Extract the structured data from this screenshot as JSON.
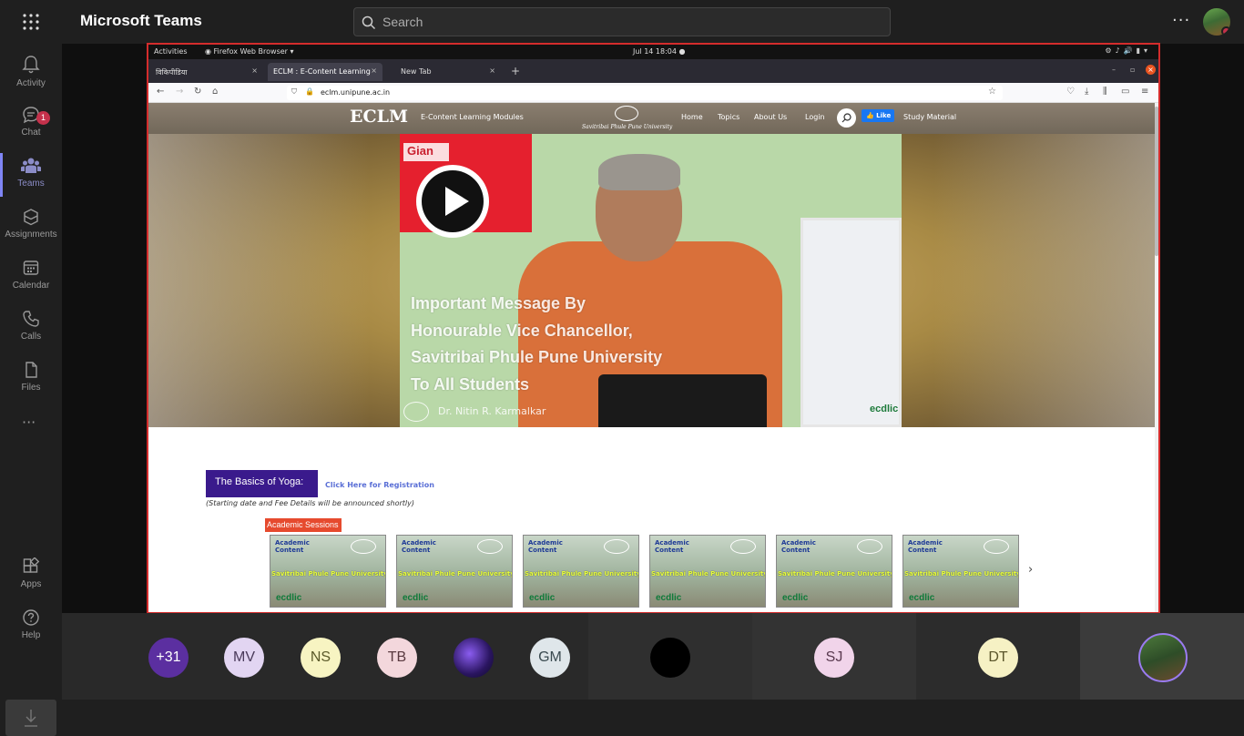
{
  "teams": {
    "title": "Microsoft Teams",
    "search_placeholder": "Search",
    "more_label": "···"
  },
  "rail": {
    "items": [
      {
        "label": "Activity",
        "icon": "bell-icon"
      },
      {
        "label": "Chat",
        "icon": "chat-icon",
        "badge": "1"
      },
      {
        "label": "Teams",
        "icon": "teams-icon"
      },
      {
        "label": "Assignments",
        "icon": "assignments-icon"
      },
      {
        "label": "Calendar",
        "icon": "calendar-icon"
      },
      {
        "label": "Calls",
        "icon": "phone-icon"
      },
      {
        "label": "Files",
        "icon": "file-icon"
      }
    ],
    "more": "···",
    "apps": "Apps",
    "help": "Help"
  },
  "ubuntu": {
    "activities": "Activities",
    "app_menu": "Firefox Web Browser ▾",
    "clock": "Jul 14  18:04  ●"
  },
  "browser": {
    "tabs": [
      {
        "label": "विकिपीडिया",
        "close": "×"
      },
      {
        "label": "ECLM : E-Content Learning",
        "close": "×"
      },
      {
        "label": "New Tab",
        "close": "×"
      }
    ],
    "new_tab": "+",
    "url": "eclm.unipune.ac.in"
  },
  "site": {
    "logo": "ECLM",
    "subtitle": "E-Content Learning Modules",
    "university": "Savitribai Phule Pune University",
    "nav": [
      "Home",
      "Topics",
      "About Us",
      "Login"
    ],
    "like": "Like",
    "study": "Study Material",
    "hero": {
      "brand": "Gian",
      "message_lines": [
        "Important Message By",
        "Honourable Vice Chancellor,",
        "Savitribai Phule Pune University",
        "To All Students"
      ],
      "presenter": "Dr. Nitin R. Karmalkar",
      "watermark": "ecdlic"
    },
    "yoga": {
      "title": "The Basics of Yoga:",
      "link": "Click Here for Registration",
      "note": "(Starting date and Fee Details will be announced shortly)"
    },
    "academic_label": "Academic Sessions",
    "card": {
      "top_line1": "Academic",
      "top_line2": "Content",
      "univ": "Savitribai Phule Pune University",
      "brand": "ecdlic"
    },
    "next": "›"
  },
  "call": {
    "participants": [
      {
        "initials": "+31",
        "bg": "#5b2fa0",
        "fg": "#ffffff"
      },
      {
        "initials": "MV",
        "bg": "#e2d5f2",
        "fg": "#4a3a5a"
      },
      {
        "initials": "NS",
        "bg": "#f7f4c2",
        "fg": "#5b5a2a"
      },
      {
        "initials": "TB",
        "bg": "#f3d7dc",
        "fg": "#5a3a40"
      },
      {
        "initials": "",
        "bg": "#2a1560",
        "fg": "#ffffff"
      },
      {
        "initials": "GM",
        "bg": "#dfe6ea",
        "fg": "#3a4a50"
      },
      {
        "initials": "",
        "bg": "#000000",
        "fg": "#ffffff"
      },
      {
        "initials": "SJ",
        "bg": "#f1d4ea",
        "fg": "#5a3a50"
      },
      {
        "initials": "DT",
        "bg": "#f6f1c4",
        "fg": "#5a552a"
      }
    ]
  }
}
